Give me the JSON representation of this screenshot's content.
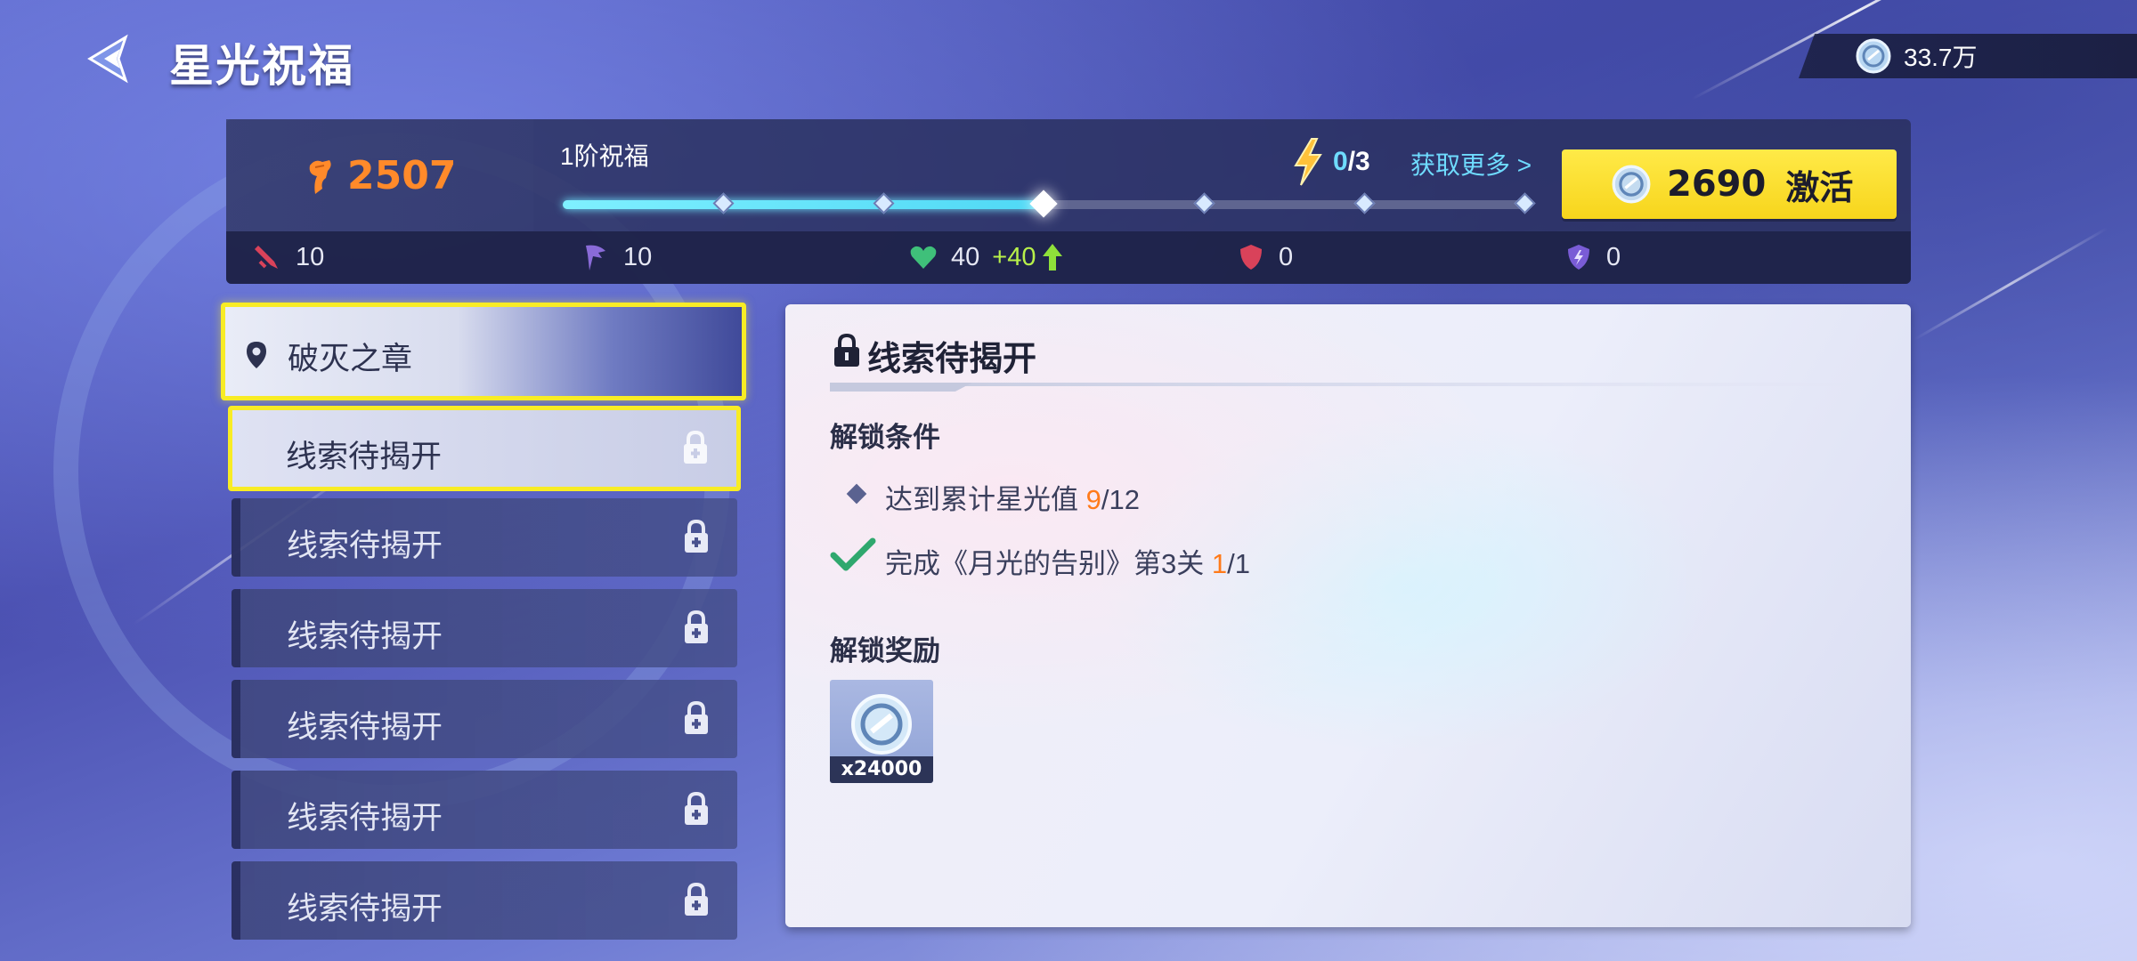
{
  "header": {
    "title": "星光祝福",
    "currency_value": "33.7万"
  },
  "blessing": {
    "score": "2507",
    "tier_label": "1阶祝福",
    "energy_current": "0",
    "energy_sep_total": "/3",
    "more_link": "获取更多 >",
    "activate_cost": "2690",
    "activate_label": "激活",
    "progress_nodes": 6,
    "progress_active_node": 3
  },
  "stats": [
    {
      "icon": "sword-icon",
      "value": "10"
    },
    {
      "icon": "claw-icon",
      "value": "10"
    },
    {
      "icon": "heart-icon",
      "value": "40",
      "bonus": "+40"
    },
    {
      "icon": "shield-icon",
      "value": "0"
    },
    {
      "icon": "lightning-shield-icon",
      "value": "0"
    }
  ],
  "chapter": {
    "title": "破灭之章"
  },
  "clues": [
    {
      "label": "线索待揭开",
      "selected": true
    },
    {
      "label": "线索待揭开",
      "selected": false
    },
    {
      "label": "线索待揭开",
      "selected": false
    },
    {
      "label": "线索待揭开",
      "selected": false
    },
    {
      "label": "线索待揭开",
      "selected": false
    },
    {
      "label": "线索待揭开",
      "selected": false
    }
  ],
  "detail": {
    "title": "线索待揭开",
    "conditions_heading": "解锁条件",
    "condition1_text": "达到累计星光值",
    "condition1_current": "9",
    "condition1_total": "/12",
    "condition2_text": "完成《月光的告别》第3关",
    "condition2_current": "1",
    "condition2_total": "/1",
    "rewards_heading": "解锁奖励",
    "reward_qty": "x24000"
  },
  "colors": {
    "accent_yellow": "#f8ec25",
    "score_orange": "#ff8a2a",
    "link_cyan": "#6fdcff",
    "bonus_green": "#b8f04a"
  }
}
